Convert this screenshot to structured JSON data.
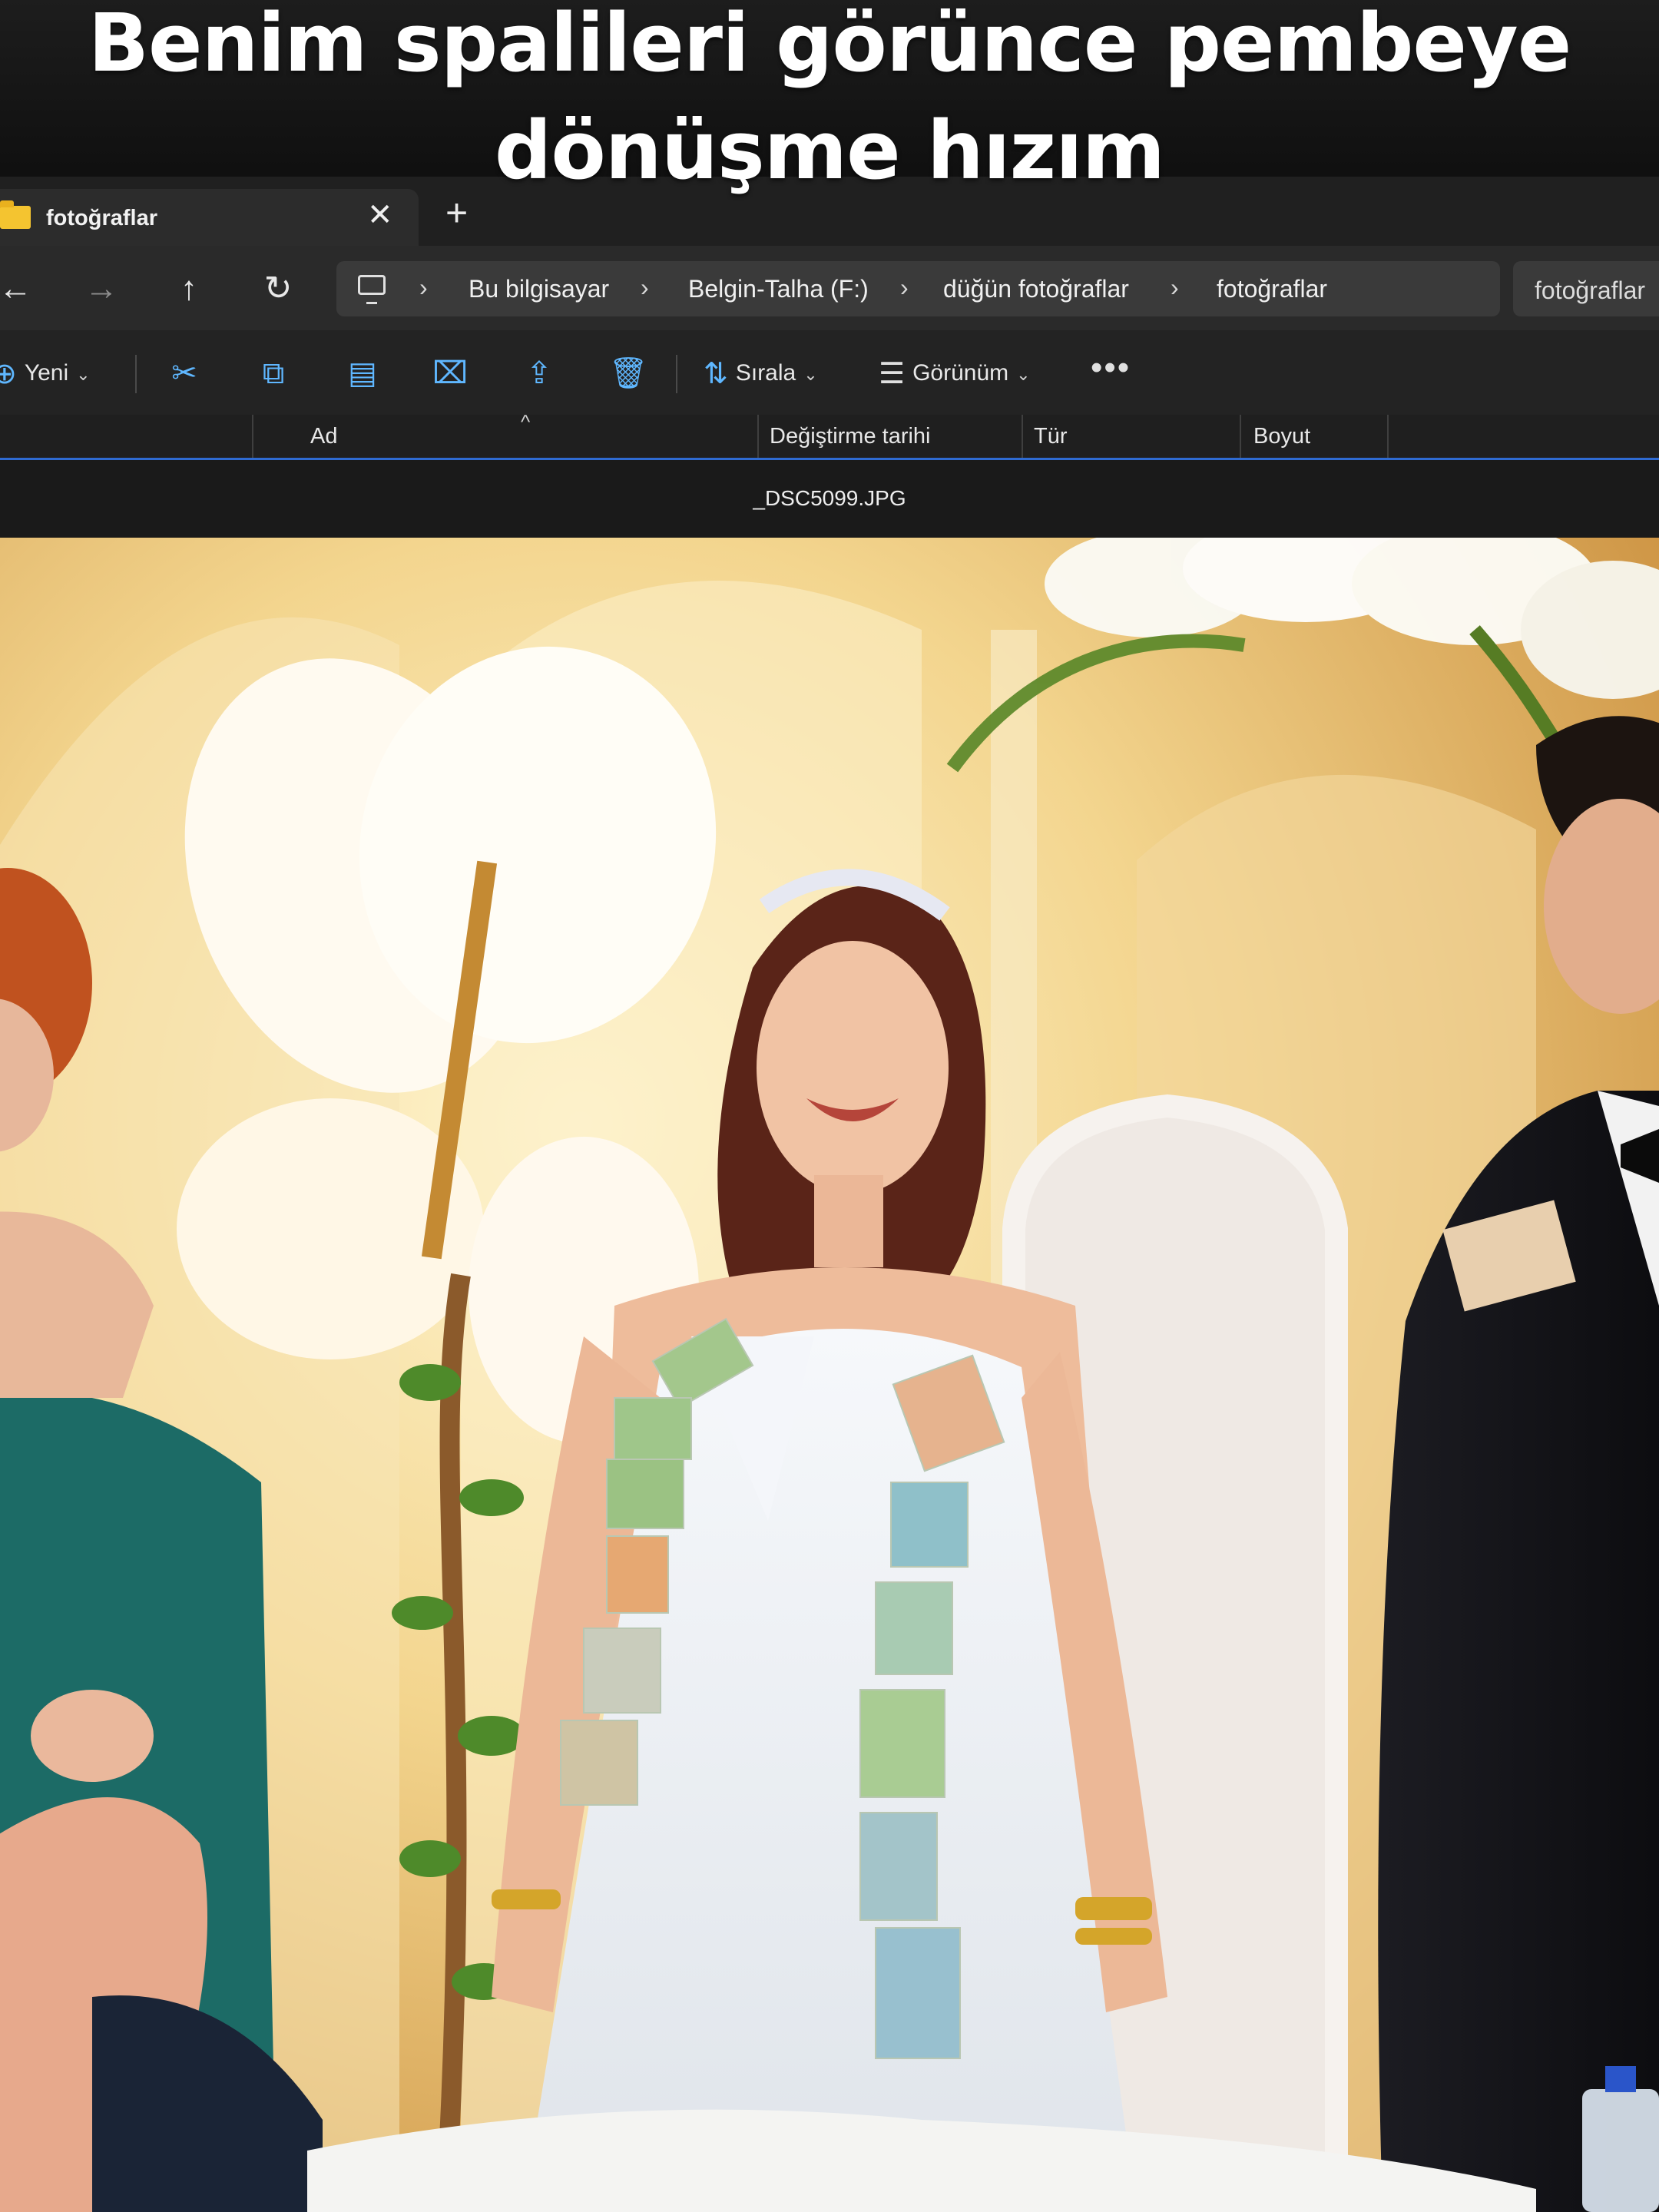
{
  "caption": {
    "line1": "Benim spalileri görünce pembeye",
    "line2": "dönüşme hızım"
  },
  "window": {
    "tab_title": "fotoğraflar",
    "tab_close": "✕",
    "new_tab": "+"
  },
  "nav": {
    "back": "←",
    "forward": "→",
    "up": "↑",
    "refresh": "↻"
  },
  "breadcrumbs": [
    "Bu bilgisayar",
    "Belgin-Talha (F:)",
    "düğün fotoğraflar",
    "fotoğraflar"
  ],
  "search": {
    "value": "fotoğraflar"
  },
  "toolbar": {
    "new_label": "Yeni",
    "sort_label": "Sırala",
    "view_label": "Görünüm",
    "more": "•••",
    "tools": [
      "cut-icon",
      "copy-icon",
      "paste-icon",
      "rename-icon",
      "share-icon",
      "delete-icon"
    ]
  },
  "columns": [
    "Ad",
    "Değiştirme tarihi",
    "Tür",
    "Boyut"
  ],
  "viewer": {
    "filename": "_DSC5099.JPG"
  },
  "colors": {
    "accent": "#2f6bd2",
    "icon_blue": "#5fb7ff",
    "folder": "#f4c430"
  }
}
